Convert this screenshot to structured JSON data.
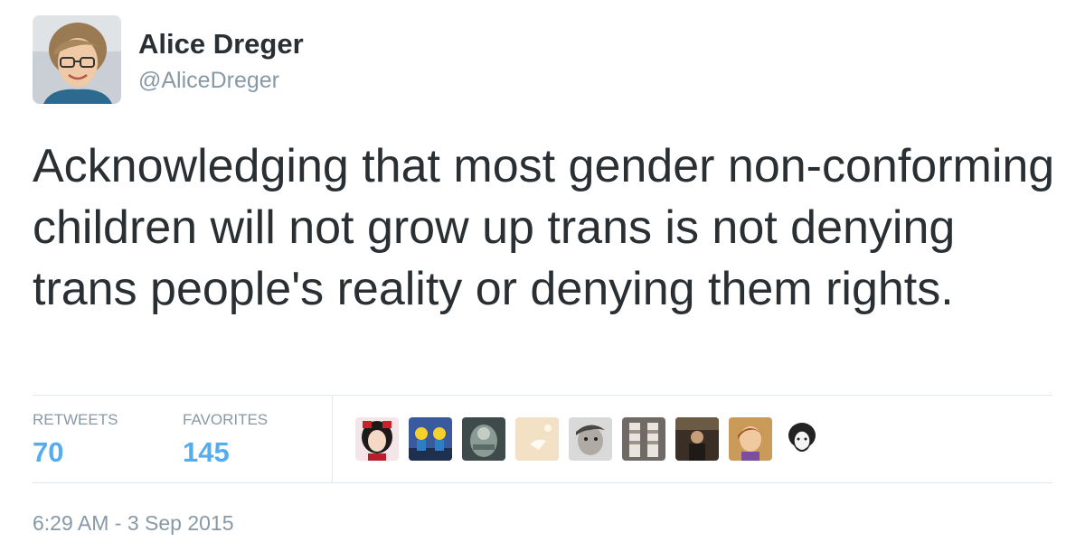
{
  "tweet": {
    "author": {
      "name": "Alice Dreger",
      "handle": "@AliceDreger"
    },
    "text": "Acknowledging that most gender non-conforming children will not grow up trans is not denying trans people's reality or denying them rights.",
    "stats": {
      "retweets_label": "RETWEETS",
      "retweets_count": "70",
      "favorites_label": "FAVORITES",
      "favorites_count": "145"
    },
    "timestamp": "6:29 AM - 3 Sep 2015"
  },
  "colors": {
    "link_blue": "#55acee",
    "muted_gray": "#8899a6",
    "text_dark": "#292f33",
    "divider": "#e1e8ed"
  }
}
